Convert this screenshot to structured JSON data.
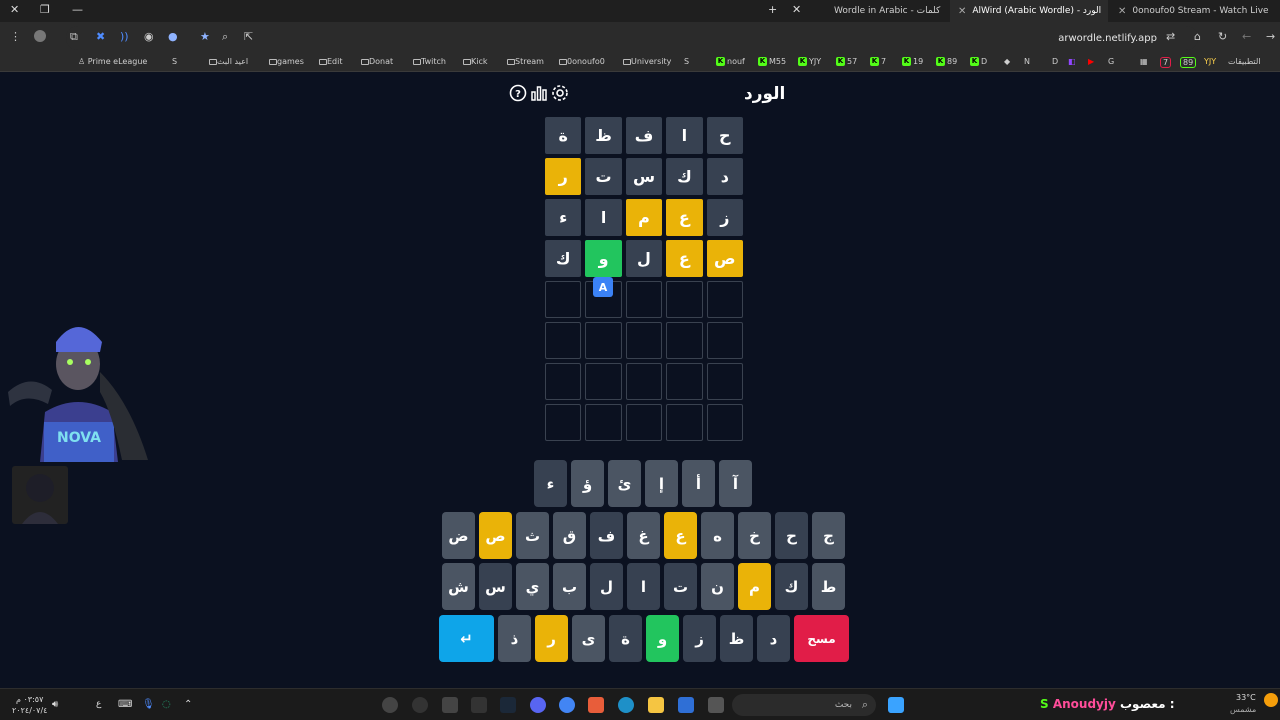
{
  "browser": {
    "tabs": [
      {
        "title": "0onoufo0 Stream - Watch Live",
        "active": false
      },
      {
        "title": "AlWird (Arabic Wordle) - الورد",
        "active": true
      },
      {
        "title": "Wordle in Arabic - كلمات",
        "active": false
      }
    ],
    "url": "arwordle.netlify.app",
    "bookmarks": [
      "التطبيقات",
      "YJY",
      "89",
      "7",
      "N",
      "D",
      "89",
      "19",
      "7",
      "57",
      "YJY",
      "M55",
      "nouf",
      "S",
      "University",
      "0onoufo0",
      "Stream",
      "Kick",
      "Twitch",
      "Donat",
      "Edit",
      "games",
      "اعيد البث",
      "S",
      "Prime eLeague"
    ]
  },
  "game": {
    "title": "الورد",
    "grid": [
      [
        {
          "l": "ح",
          "s": "absent"
        },
        {
          "l": "ا",
          "s": "absent"
        },
        {
          "l": "ف",
          "s": "absent"
        },
        {
          "l": "ظ",
          "s": "absent"
        },
        {
          "l": "ة",
          "s": "absent"
        }
      ],
      [
        {
          "l": "د",
          "s": "absent"
        },
        {
          "l": "ك",
          "s": "absent"
        },
        {
          "l": "س",
          "s": "absent"
        },
        {
          "l": "ت",
          "s": "absent"
        },
        {
          "l": "ر",
          "s": "present"
        }
      ],
      [
        {
          "l": "ز",
          "s": "absent"
        },
        {
          "l": "ع",
          "s": "present"
        },
        {
          "l": "م",
          "s": "present"
        },
        {
          "l": "ا",
          "s": "absent"
        },
        {
          "l": "ء",
          "s": "absent"
        }
      ],
      [
        {
          "l": "ص",
          "s": "present"
        },
        {
          "l": "ع",
          "s": "present"
        },
        {
          "l": "ل",
          "s": "absent"
        },
        {
          "l": "و",
          "s": "correct"
        },
        {
          "l": "ك",
          "s": "absent"
        }
      ],
      [
        {
          "l": "",
          "s": "empty"
        },
        {
          "l": "",
          "s": "empty"
        },
        {
          "l": "",
          "s": "empty"
        },
        {
          "l": "",
          "s": "empty"
        },
        {
          "l": "",
          "s": "empty"
        }
      ],
      [
        {
          "l": "",
          "s": "empty"
        },
        {
          "l": "",
          "s": "empty"
        },
        {
          "l": "",
          "s": "empty"
        },
        {
          "l": "",
          "s": "empty"
        },
        {
          "l": "",
          "s": "empty"
        }
      ],
      [
        {
          "l": "",
          "s": "empty"
        },
        {
          "l": "",
          "s": "empty"
        },
        {
          "l": "",
          "s": "empty"
        },
        {
          "l": "",
          "s": "empty"
        },
        {
          "l": "",
          "s": "empty"
        }
      ],
      [
        {
          "l": "",
          "s": "empty"
        },
        {
          "l": "",
          "s": "empty"
        },
        {
          "l": "",
          "s": "empty"
        },
        {
          "l": "",
          "s": "empty"
        },
        {
          "l": "",
          "s": "empty"
        }
      ]
    ],
    "keyboard": [
      [
        {
          "l": "آ",
          "s": "unused"
        },
        {
          "l": "أ",
          "s": "unused"
        },
        {
          "l": "إ",
          "s": "unused"
        },
        {
          "l": "ئ",
          "s": "unused"
        },
        {
          "l": "ؤ",
          "s": "unused"
        },
        {
          "l": "ء",
          "s": "absent"
        }
      ],
      [
        {
          "l": "ج",
          "s": "unused"
        },
        {
          "l": "ح",
          "s": "absent"
        },
        {
          "l": "خ",
          "s": "unused"
        },
        {
          "l": "ه",
          "s": "unused"
        },
        {
          "l": "ع",
          "s": "present"
        },
        {
          "l": "غ",
          "s": "unused"
        },
        {
          "l": "ف",
          "s": "absent"
        },
        {
          "l": "ق",
          "s": "unused"
        },
        {
          "l": "ث",
          "s": "unused"
        },
        {
          "l": "ص",
          "s": "present"
        },
        {
          "l": "ض",
          "s": "unused"
        }
      ],
      [
        {
          "l": "ط",
          "s": "unused"
        },
        {
          "l": "ك",
          "s": "absent"
        },
        {
          "l": "م",
          "s": "present"
        },
        {
          "l": "ن",
          "s": "unused"
        },
        {
          "l": "ت",
          "s": "absent"
        },
        {
          "l": "ا",
          "s": "absent"
        },
        {
          "l": "ل",
          "s": "absent"
        },
        {
          "l": "ب",
          "s": "unused"
        },
        {
          "l": "ي",
          "s": "unused"
        },
        {
          "l": "س",
          "s": "absent"
        },
        {
          "l": "ش",
          "s": "unused"
        }
      ],
      [
        {
          "l": "مسح",
          "s": "delete"
        },
        {
          "l": "د",
          "s": "absent"
        },
        {
          "l": "ظ",
          "s": "absent"
        },
        {
          "l": "ز",
          "s": "absent"
        },
        {
          "l": "و",
          "s": "correct"
        },
        {
          "l": "ة",
          "s": "absent"
        },
        {
          "l": "ى",
          "s": "unused"
        },
        {
          "l": "ر",
          "s": "present"
        },
        {
          "l": "ذ",
          "s": "unused"
        },
        {
          "l": "↵",
          "s": "enter"
        }
      ]
    ]
  },
  "taskbar": {
    "search_placeholder": "بحث",
    "streamer_prefix": "معصوب :",
    "streamer_name": "Anoudyjy",
    "weather_temp": "33°C",
    "weather_desc": "مشمس",
    "time": "٠٣:٥٧ م",
    "date": "٢٠٢٤/٠٧/٤",
    "lang": "ع"
  },
  "colors": {
    "absent": "#374151",
    "present": "#eab308",
    "correct": "#22c55e",
    "bg": "#0b1120"
  }
}
